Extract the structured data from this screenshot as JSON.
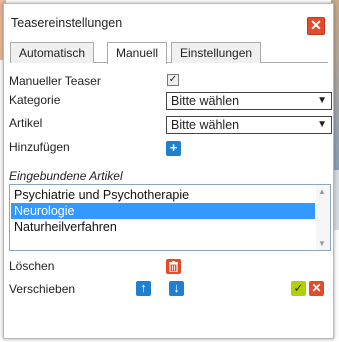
{
  "dialog": {
    "title": "Teasereinstellungen",
    "close_symbol": "✕"
  },
  "tabs": [
    {
      "label": "Automatisch"
    },
    {
      "label": "Manuell"
    },
    {
      "label": "Einstellungen"
    }
  ],
  "form": {
    "manual_teaser_label": "Manueller Teaser",
    "manual_teaser_checked": true,
    "category_label": "Kategorie",
    "category_value": "Bitte wählen",
    "article_label": "Artikel",
    "article_value": "Bitte wählen",
    "add_label": "Hinzufügen",
    "add_symbol": "+"
  },
  "embedded": {
    "title": "Eingebundene Artikel",
    "items": [
      {
        "label": "Psychiatrie und Psychotherapie",
        "selected": false
      },
      {
        "label": "Neurologie",
        "selected": true
      },
      {
        "label": "Naturheilverfahren",
        "selected": false
      }
    ]
  },
  "actions": {
    "delete_label": "Löschen",
    "move_label": "Verschieben",
    "move_up_symbol": "↑",
    "move_down_symbol": "↓",
    "ok_symbol": "✓",
    "cancel_symbol": "✕"
  },
  "icons": {
    "close": "close-icon",
    "checkbox": "checkmark-icon",
    "dropdown": "chevron-down-icon",
    "add": "plus-icon",
    "trash": "trash-icon",
    "up": "arrow-up-icon",
    "down": "arrow-down-icon",
    "ok": "check-icon",
    "cancel": "cross-icon"
  },
  "colors": {
    "accent_blue": "#1f7fd0",
    "danger_red": "#e54b2a",
    "ok_green": "#b5d000",
    "selection_blue": "#3399ff"
  }
}
